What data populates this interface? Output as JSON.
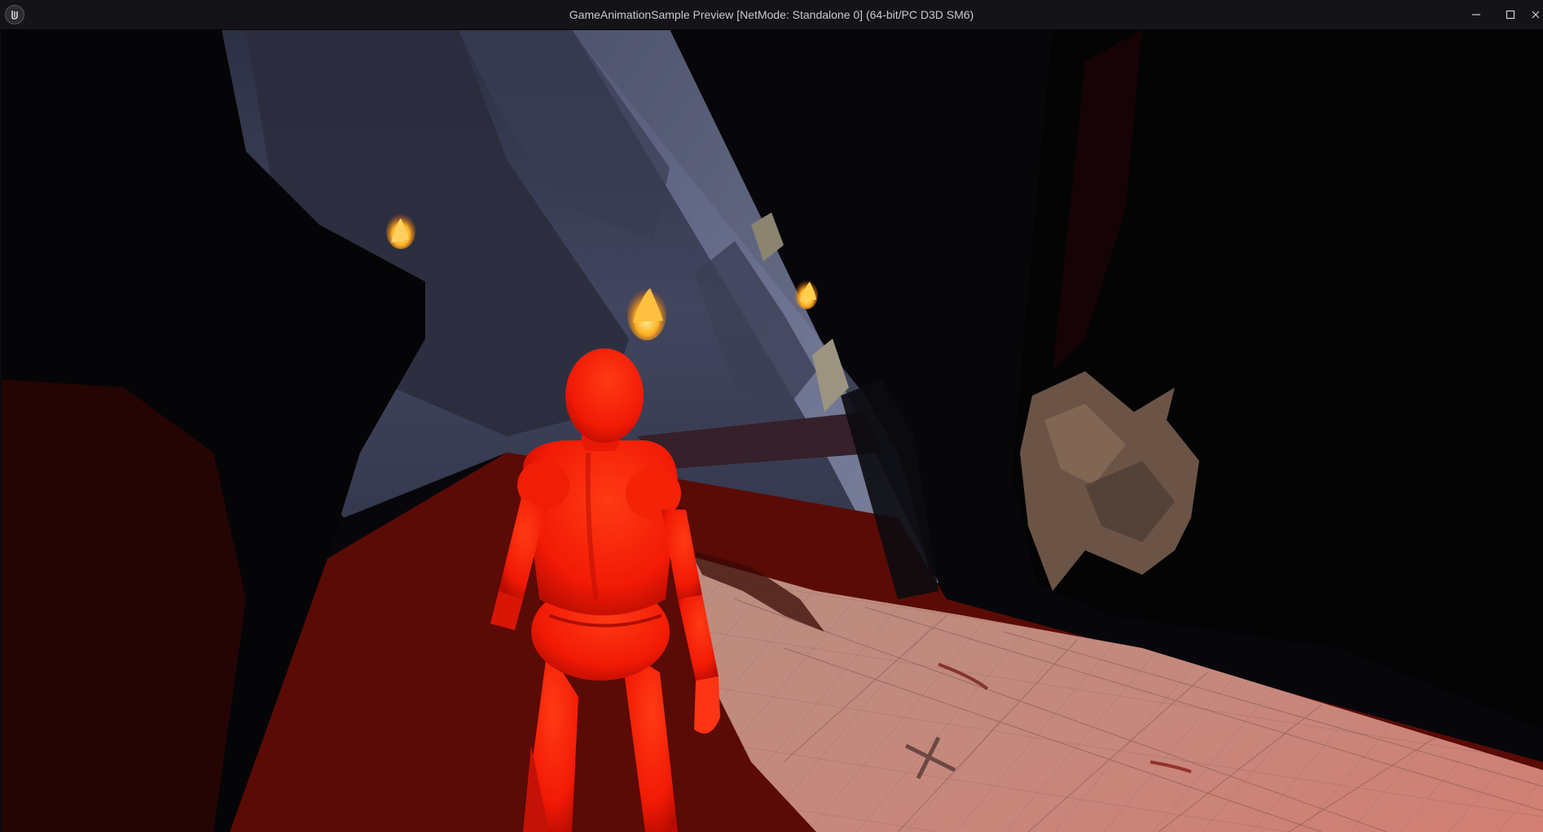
{
  "window": {
    "title": "GameAnimationSample Preview [NetMode: Standalone 0]  (64-bit/PC D3D SM6)",
    "logo_icon": "unreal-engine-logo-icon",
    "controls": {
      "minimize_icon": "minimize-icon",
      "maximize_icon": "maximize-icon",
      "close_icon": "close-icon"
    }
  },
  "scene": {
    "description_icons": [
      "mannequin-character",
      "cave-rock-wall",
      "torch-flame",
      "tile-floor",
      "floor-cross-marker"
    ],
    "colors": {
      "mannequin": "#ff2a0a",
      "floor_lit": "#c98d82",
      "floor_shadow": "#5a0b06",
      "cave_sky": "#4a4f6e",
      "flame": "#ffb020",
      "rock": "#6b5446"
    }
  }
}
